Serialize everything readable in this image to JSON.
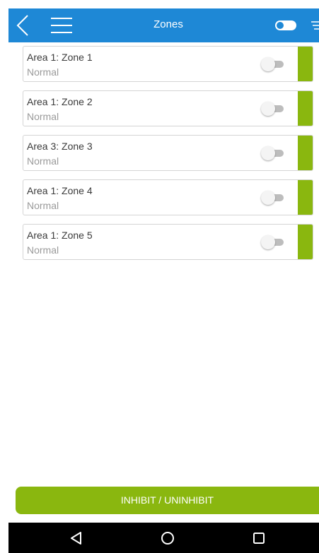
{
  "header": {
    "title": "Zones",
    "back_icon": "chevron-left-icon",
    "menu_icon": "hamburger-menu-icon",
    "toggle_state": "on",
    "filter_icon": "filter-icon",
    "background_color": "#1e88d6"
  },
  "zones": [
    {
      "name": "Area 1: Zone 1",
      "status": "Normal",
      "toggle": "off",
      "indicator_color": "#8ab70f"
    },
    {
      "name": "Area 1: Zone 2",
      "status": "Normal",
      "toggle": "off",
      "indicator_color": "#8ab70f"
    },
    {
      "name": "Area 3: Zone 3",
      "status": "Normal",
      "toggle": "off",
      "indicator_color": "#8ab70f"
    },
    {
      "name": "Area 1: Zone 4",
      "status": "Normal",
      "toggle": "off",
      "indicator_color": "#8ab70f"
    },
    {
      "name": "Area 1: Zone 5",
      "status": "Normal",
      "toggle": "off",
      "indicator_color": "#8ab70f"
    }
  ],
  "action": {
    "label": "INHIBIT / UNINHIBIT",
    "color": "#8ab70f"
  },
  "nav_bar": {
    "back_icon": "triangle-back-icon",
    "home_icon": "circle-home-icon",
    "recents_icon": "square-recents-icon"
  }
}
